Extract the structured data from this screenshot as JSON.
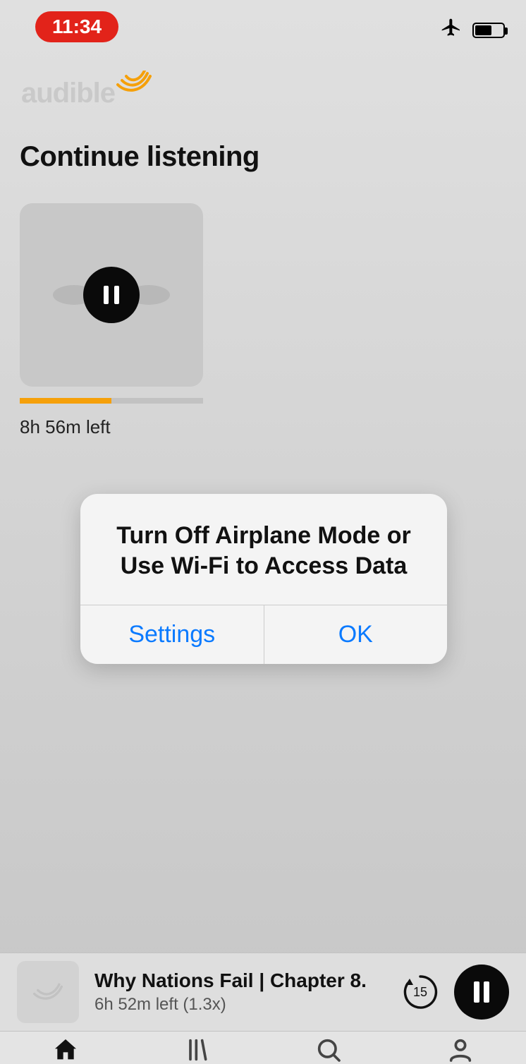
{
  "status": {
    "time": "11:34",
    "battery_pct": 55
  },
  "logo": {
    "text": "audible"
  },
  "section": {
    "title": "Continue listening"
  },
  "book": {
    "progress_pct": 50,
    "time_left": "8h 56m left"
  },
  "alert": {
    "title": "Turn Off Airplane Mode or Use Wi-Fi to Access Data",
    "settings_label": "Settings",
    "ok_label": "OK"
  },
  "mini_player": {
    "title": "Why Nations Fail | Chapter 8. ",
    "subtitle": "6h 52m left (1.3x)",
    "rewind_seconds": "15"
  }
}
